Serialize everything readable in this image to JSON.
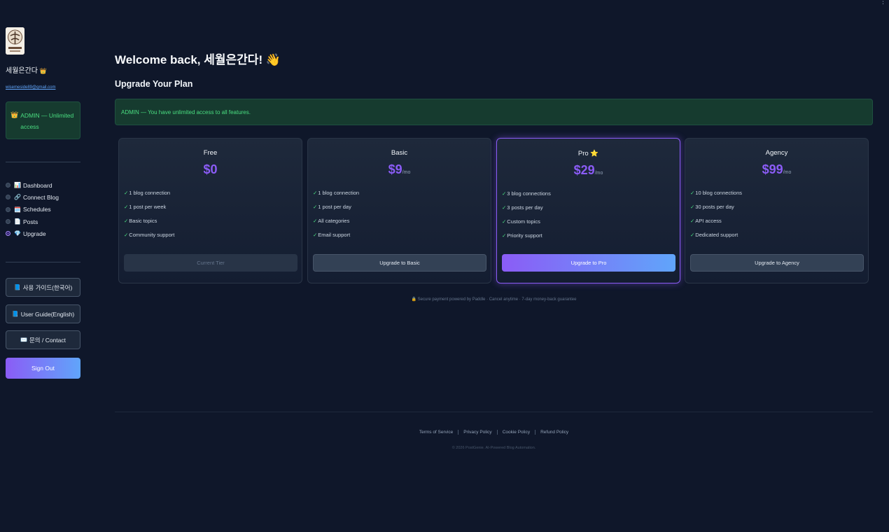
{
  "user": {
    "name": "세월은간다",
    "name_emoji": "👑",
    "email": "wisemeside89@gmail.com"
  },
  "sidebar": {
    "admin_icon": "👑",
    "admin_text": "ADMIN — Unlimited access",
    "nav": [
      {
        "icon": "📊",
        "label": "Dashboard",
        "active": false
      },
      {
        "icon": "🔗",
        "label": "Connect Blog",
        "active": false
      },
      {
        "icon": "🗓️",
        "label": "Schedules",
        "active": false
      },
      {
        "icon": "📄",
        "label": "Posts",
        "active": false
      },
      {
        "icon": "💎",
        "label": "Upgrade",
        "active": true
      }
    ],
    "guide_ko": {
      "icon": "📘",
      "label": "사용 가이드(한국어)"
    },
    "guide_en": {
      "icon": "📘",
      "label": "User Guide(English)"
    },
    "contact": {
      "icon": "✉️",
      "label": "문의 / Contact"
    },
    "sign_out": "Sign Out"
  },
  "main": {
    "welcome": "Welcome back, 세월은간다! 👋",
    "section_title": "Upgrade Your Plan",
    "banner": "ADMIN — You have unlimited access to all features."
  },
  "plans": [
    {
      "name": "Free",
      "price": "$0",
      "period": "",
      "features": [
        "1 blog connection",
        "1 post per week",
        "Basic topics",
        "Community support"
      ],
      "button": "Current Tier"
    },
    {
      "name": "Basic",
      "price": "$9",
      "period": "/mo",
      "features": [
        "1 blog connection",
        "1 post per day",
        "All categories",
        "Email support"
      ],
      "button": "Upgrade to Basic"
    },
    {
      "name": "Pro ⭐",
      "price": "$29",
      "period": "/mo",
      "features": [
        "3 blog connections",
        "3 posts per day",
        "Custom topics",
        "Priority support"
      ],
      "button": "Upgrade to Pro"
    },
    {
      "name": "Agency",
      "price": "$99",
      "period": "/mo",
      "features": [
        "10 blog connections",
        "30 posts per day",
        "API access",
        "Dedicated support"
      ],
      "button": "Upgrade to Agency"
    }
  ],
  "check_mark": "✓",
  "secure_note": "🔒 Secure payment powered by Paddle · Cancel anytime · 7-day money-back guarantee",
  "footer": {
    "links": [
      "Terms of Service",
      "Privacy Policy",
      "Cookie Policy",
      "Refund Policy"
    ],
    "copyright": "© 2026 PostGenie. AI-Powered Blog Automation."
  },
  "menu_icon": "⋮",
  "colors": {
    "background": "#0f172a",
    "accent": "#8b5cf6",
    "success": "#4ade80",
    "gradient_end": "#60a5fa"
  }
}
